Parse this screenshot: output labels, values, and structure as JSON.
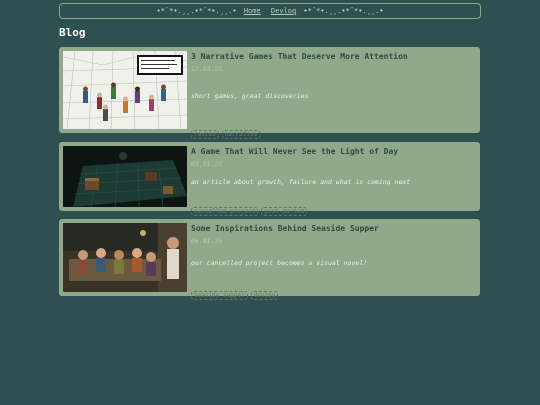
{
  "nav": {
    "deco_left": "•*¨*•.¸¸.•*¨*•.¸¸.•",
    "deco_right": "•*¨*•.¸¸.•*¨*•.¸¸.•",
    "links": [
      "Home",
      "Devlog"
    ]
  },
  "page_title": "Blog",
  "posts": [
    {
      "title": "3 Narrative Games That Deserve More Attention",
      "date": "12.03.25",
      "description": "short games, great discoveries",
      "tags": [
        "review",
        "narrative"
      ]
    },
    {
      "title": "A Game That Will Never See the Light of Day",
      "date": "03.01.25",
      "description": "an article about growth, failure and what is coming next",
      "tags": [
        "cancelled project",
        "post-mortem"
      ]
    },
    {
      "title": "Some Inspirations Behind Seaside Supper",
      "date": "06.01.25",
      "description": "our cancelled project becomes a visual novel!",
      "tags": [
        "seaside supper",
        "devlog"
      ]
    }
  ]
}
